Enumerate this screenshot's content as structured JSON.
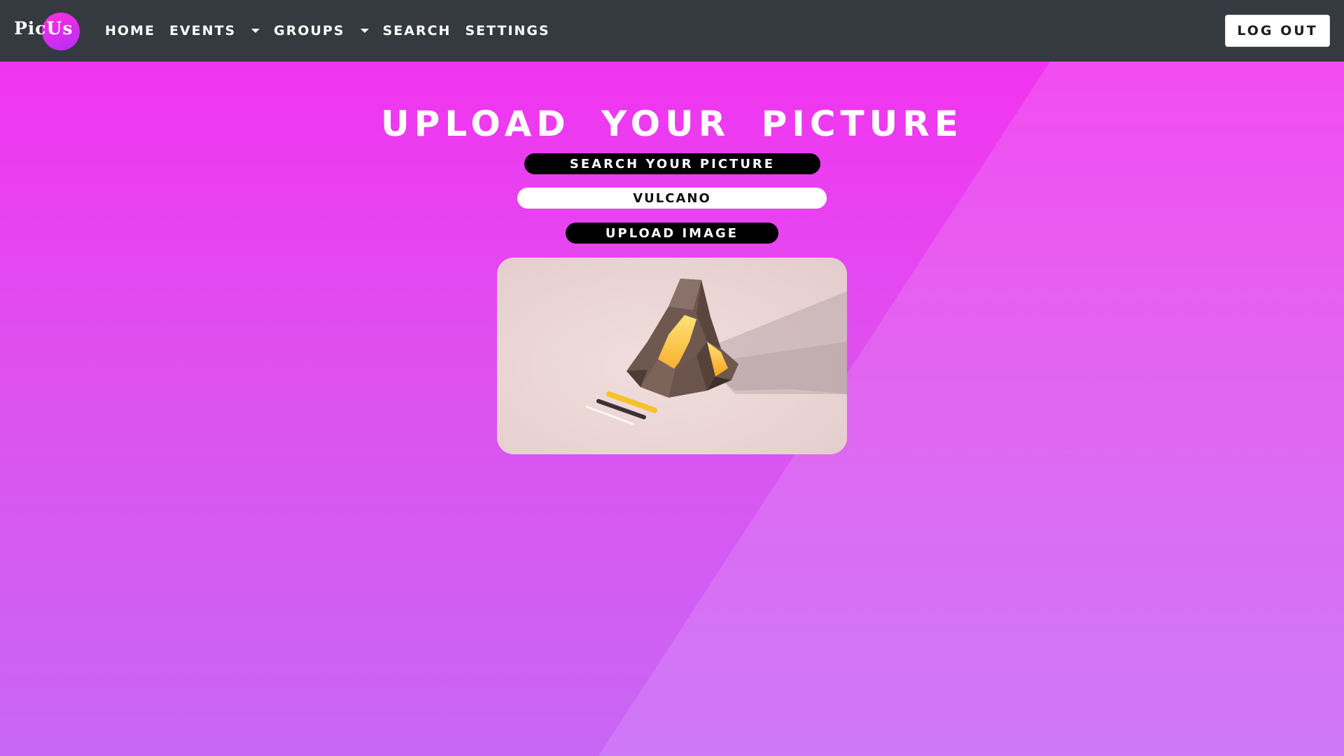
{
  "navbar": {
    "brand": "PicUs",
    "items": [
      {
        "label": "HOME",
        "dropdown": false
      },
      {
        "label": "EVENTS",
        "dropdown": true
      },
      {
        "label": "GROUPS",
        "dropdown": true
      },
      {
        "label": "SEARCH",
        "dropdown": false
      },
      {
        "label": "SETTINGS",
        "dropdown": false
      }
    ],
    "logout_label": "LOG OUT"
  },
  "main": {
    "title": "UPLOAD YOUR PICTURE",
    "search_label": "SEARCH YOUR PICTURE",
    "search_value": "VULCANO",
    "upload_label": "UPLOAD IMAGE",
    "preview_image": "low-poly-volcano-illustration"
  },
  "colors": {
    "navbar": "#343a40",
    "background_top": "#f52ef0",
    "background_bottom": "#c867f6",
    "pill": "#000000"
  }
}
